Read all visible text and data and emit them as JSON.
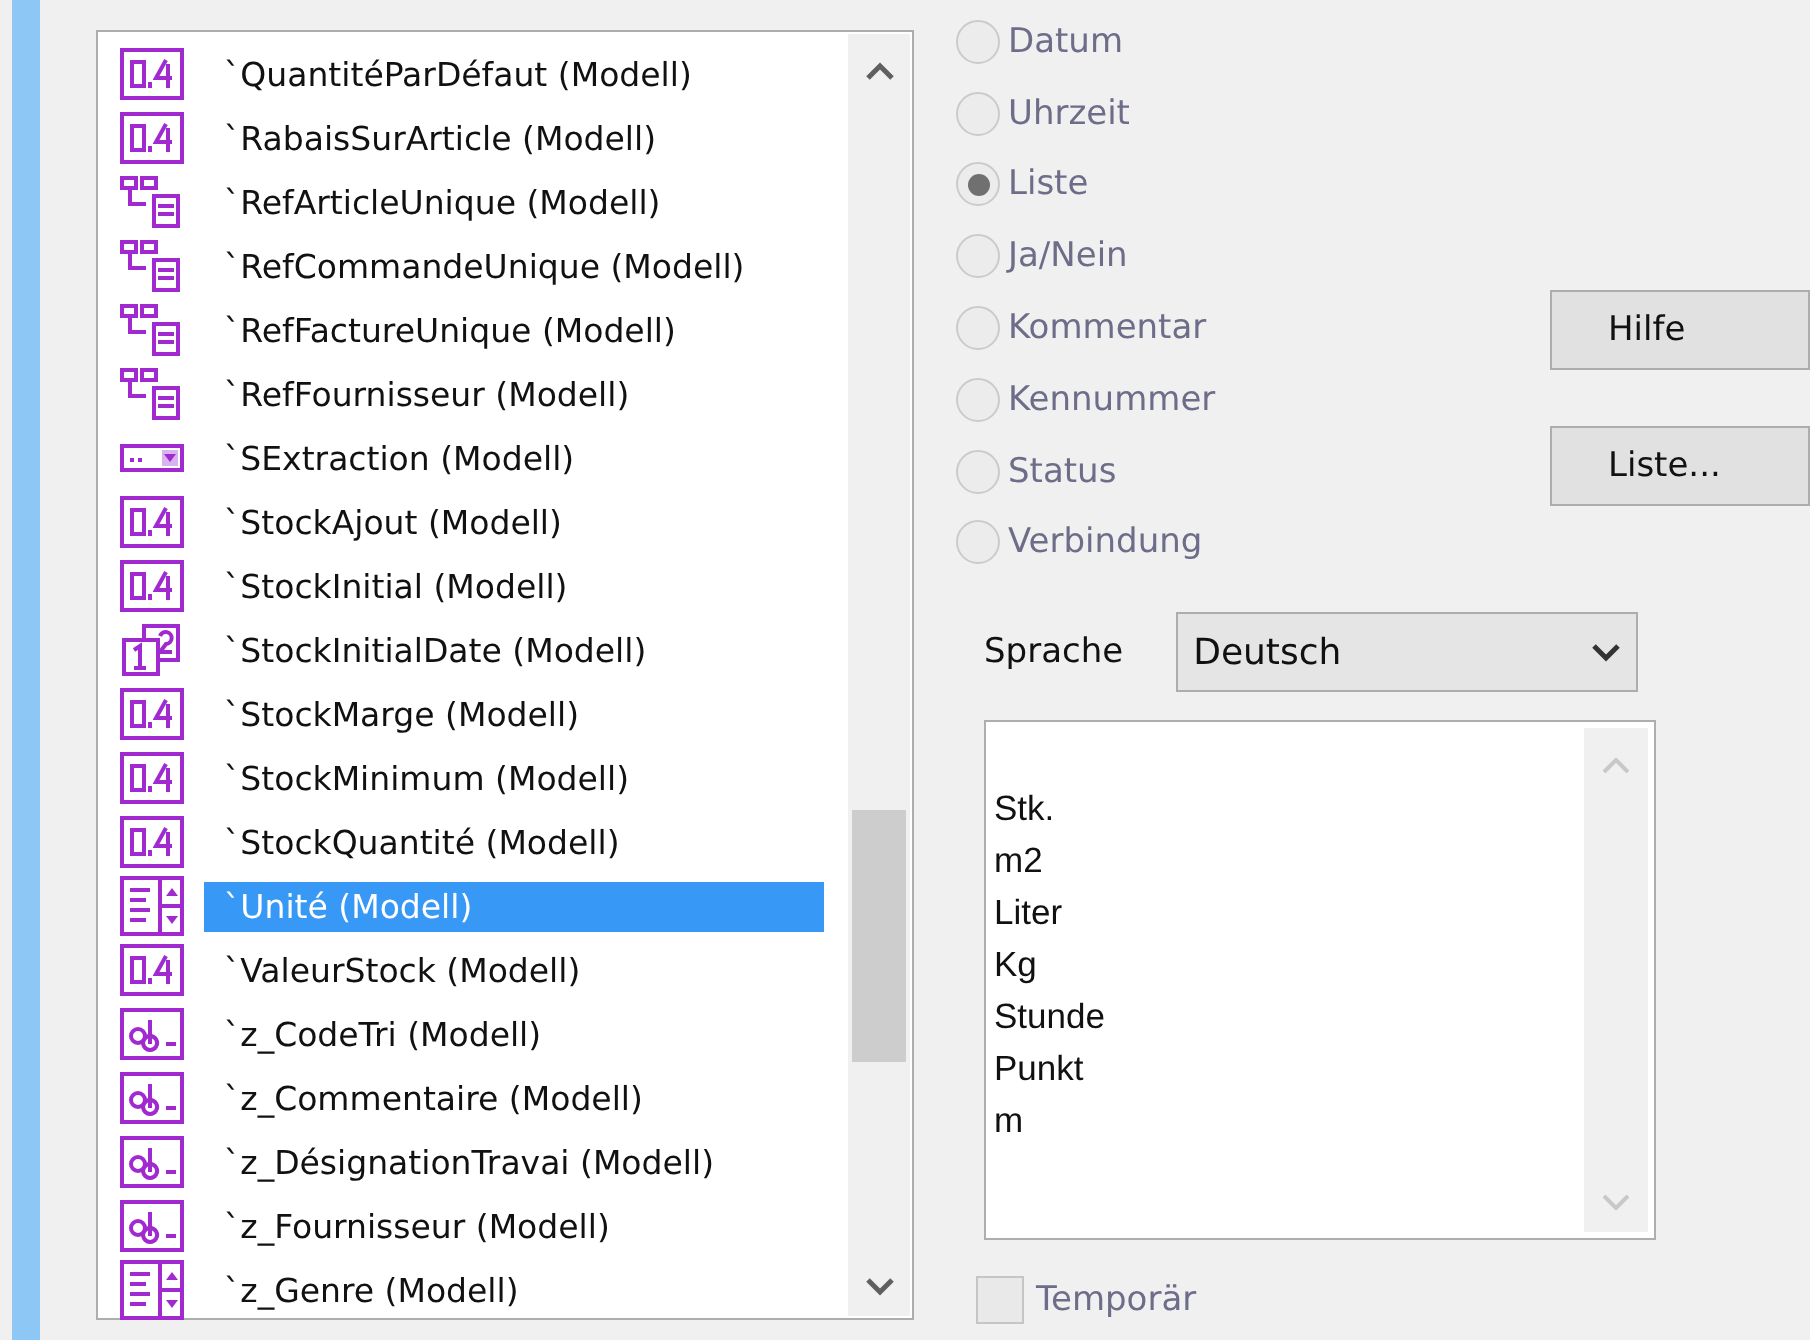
{
  "fields_list": {
    "items": [
      {
        "label": "`QuantitéParDéfaut (Modell)",
        "kind": "number",
        "selected": false
      },
      {
        "label": "`RabaisSurArticle (Modell)",
        "kind": "number",
        "selected": false
      },
      {
        "label": "`RefArticleUnique (Modell)",
        "kind": "relation",
        "selected": false
      },
      {
        "label": "`RefCommandeUnique (Modell)",
        "kind": "relation",
        "selected": false
      },
      {
        "label": "`RefFactureUnique (Modell)",
        "kind": "relation",
        "selected": false
      },
      {
        "label": "`RefFournisseur (Modell)",
        "kind": "relation",
        "selected": false
      },
      {
        "label": "`SExtraction (Modell)",
        "kind": "combo",
        "selected": false
      },
      {
        "label": "`StockAjout (Modell)",
        "kind": "number",
        "selected": false
      },
      {
        "label": "`StockInitial (Modell)",
        "kind": "number",
        "selected": false
      },
      {
        "label": "`StockInitialDate (Modell)",
        "kind": "date",
        "selected": false
      },
      {
        "label": "`StockMarge (Modell)",
        "kind": "number",
        "selected": false
      },
      {
        "label": "`StockMinimum (Modell)",
        "kind": "number",
        "selected": false
      },
      {
        "label": "`StockQuantité (Modell)",
        "kind": "number",
        "selected": false
      },
      {
        "label": "`Unité (Modell)",
        "kind": "list",
        "selected": true
      },
      {
        "label": "`ValeurStock (Modell)",
        "kind": "number",
        "selected": false
      },
      {
        "label": "`z_CodeTri (Modell)",
        "kind": "text",
        "selected": false
      },
      {
        "label": "`z_Commentaire (Modell)",
        "kind": "text",
        "selected": false
      },
      {
        "label": "`z_DésignationTravai (Modell)",
        "kind": "text",
        "selected": false
      },
      {
        "label": "`z_Fournisseur (Modell)",
        "kind": "text",
        "selected": false
      },
      {
        "label": "`z_Genre (Modell)",
        "kind": "list",
        "selected": false
      }
    ]
  },
  "field_types": [
    {
      "label": "Datum",
      "selected": false,
      "disabled": true
    },
    {
      "label": "Uhrzeit",
      "selected": false,
      "disabled": true
    },
    {
      "label": "Liste",
      "selected": true,
      "disabled": true
    },
    {
      "label": "Ja/Nein",
      "selected": false,
      "disabled": true
    },
    {
      "label": "Kommentar",
      "selected": false,
      "disabled": true
    },
    {
      "label": "Kennummer",
      "selected": false,
      "disabled": true
    },
    {
      "label": "Status",
      "selected": false,
      "disabled": true
    },
    {
      "label": "Verbindung",
      "selected": false,
      "disabled": true
    }
  ],
  "buttons": [
    "Hilfe",
    "Liste..."
  ],
  "language": {
    "label": "Sprache",
    "value": "Deutsch"
  },
  "values_box": {
    "value": "\nStk.\nm2\nLiter\nKg\nStunde\nPunkt\nm"
  },
  "temporary": {
    "label": "Temporär",
    "checked": false,
    "disabled": true
  }
}
